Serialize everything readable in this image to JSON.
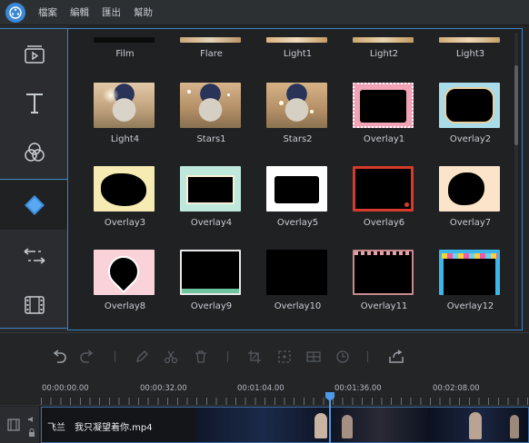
{
  "app": {
    "menu": [
      "檔案",
      "編輯",
      "匯出",
      "幫助"
    ]
  },
  "sidebar": {
    "items": [
      {
        "name": "media",
        "icon": "media-icon"
      },
      {
        "name": "text",
        "icon": "text-icon"
      },
      {
        "name": "filter",
        "icon": "filter-icon"
      },
      {
        "name": "overlay",
        "icon": "overlay-icon",
        "active": true
      },
      {
        "name": "transition",
        "icon": "transition-icon"
      },
      {
        "name": "element",
        "icon": "film-element-icon"
      }
    ]
  },
  "grid": {
    "top_row": [
      "Film",
      "Flare",
      "Light1",
      "Light2",
      "Light3"
    ],
    "rows": [
      [
        "Light4",
        "Stars1",
        "Stars2",
        "Overlay1",
        "Overlay2"
      ],
      [
        "Overlay3",
        "Overlay4",
        "Overlay5",
        "Overlay6",
        "Overlay7"
      ],
      [
        "Overlay8",
        "Overlay9",
        "Overlay10",
        "Overlay11",
        "Overlay12"
      ]
    ]
  },
  "toolbar": {
    "buttons": [
      "undo-icon",
      "redo-icon",
      "pen-icon",
      "scissors-icon",
      "trash-icon",
      "crop-icon",
      "zoom-icon",
      "split-screen-icon",
      "clock-icon",
      "export-icon"
    ]
  },
  "timeline": {
    "ticks": [
      "00:00:00.00",
      "00:00:32.00",
      "00:01:04.00",
      "00:01:36.00",
      "00:02:08.00"
    ],
    "clip": {
      "title": "飞兰　我只凝望着你.mp4"
    }
  },
  "colors": {
    "accent": "#3d82c4",
    "playhead": "#4c9ae8",
    "background": "#232527"
  }
}
